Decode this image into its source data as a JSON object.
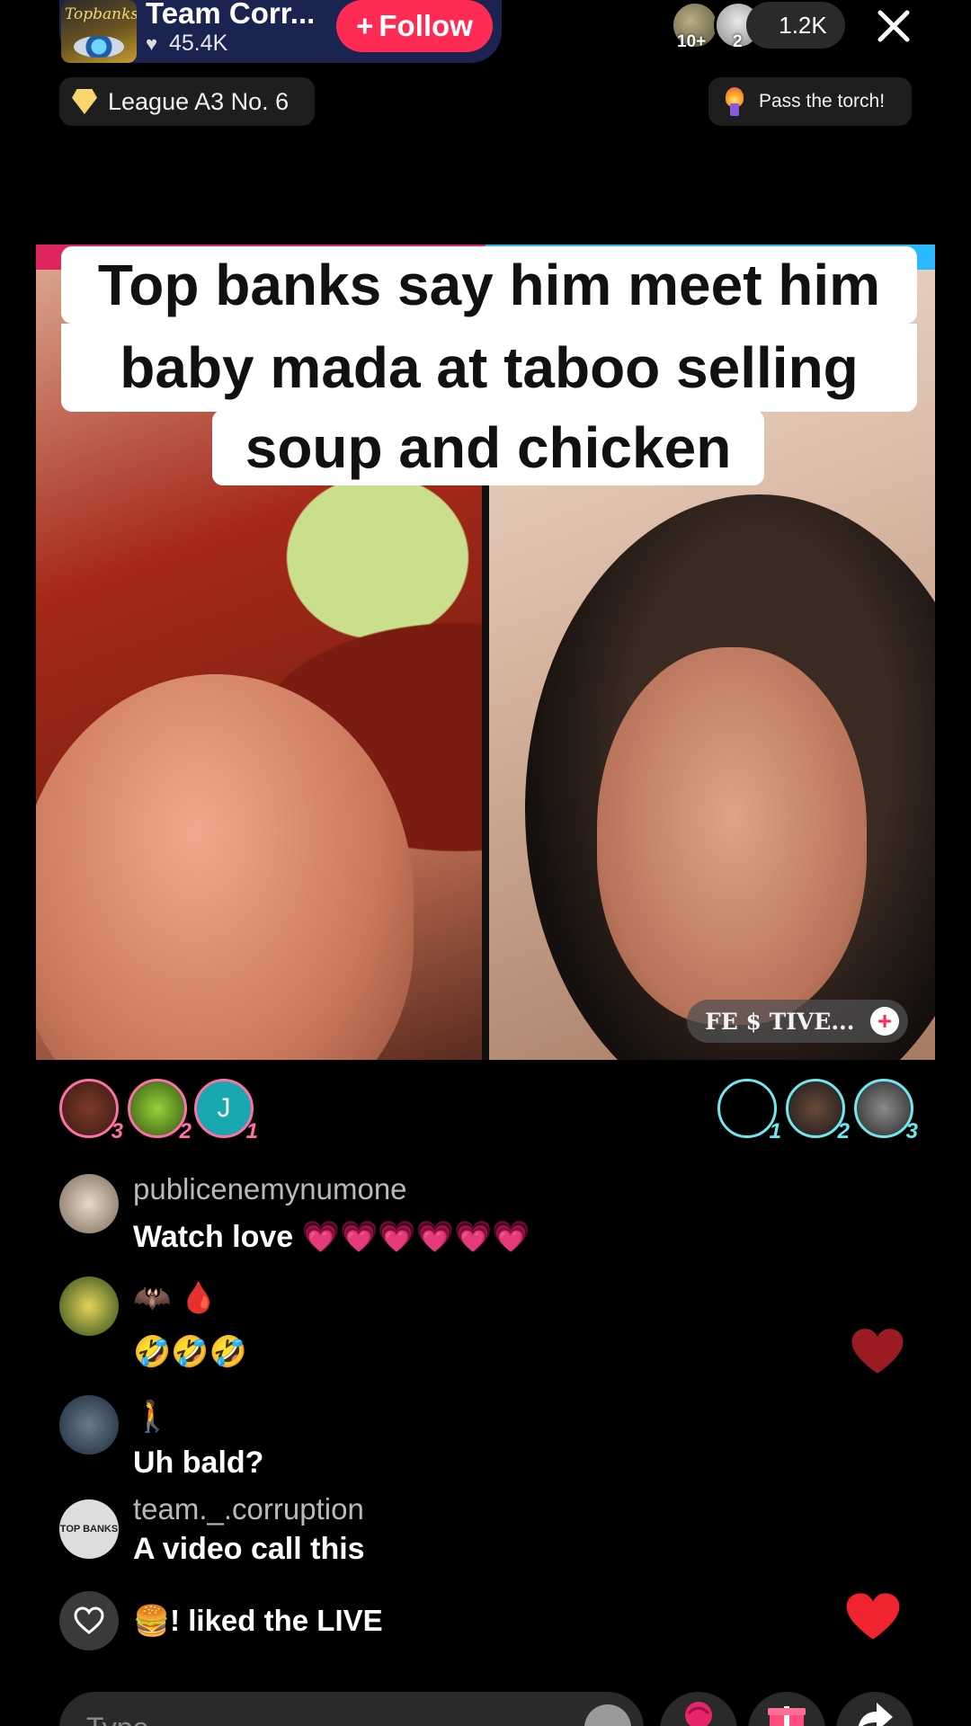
{
  "header": {
    "host_name": "Team Corr...",
    "host_logo_text": "Topbanks",
    "host_likes": "45.4K",
    "follow_label": "Follow",
    "viewer_badge_1": "10+",
    "viewer_badge_2": "2",
    "viewer_count": "1.2K",
    "league_label": "League A3 No. 6",
    "torch_label": "Pass the torch!"
  },
  "video": {
    "caption_line_1": "Top banks say him meet him",
    "caption_line_2": "baby mada at taboo selling",
    "caption_line_3": "soup and chicken",
    "guest_tag": "FE $ TIVE..."
  },
  "gifters": {
    "left": [
      {
        "rank": "3"
      },
      {
        "rank": "2"
      },
      {
        "initial": "J",
        "rank": "1"
      }
    ],
    "right": [
      {
        "rank": "1"
      },
      {
        "rank": "2"
      },
      {
        "rank": "3"
      }
    ]
  },
  "comments": [
    {
      "user": "publicenemynumone",
      "text": "Watch love 💗💗💗💗💗💗"
    },
    {
      "user": "🦇 🩸",
      "text": "🤣🤣🤣"
    },
    {
      "user": "🚶",
      "text": "Uh bald?"
    },
    {
      "user": "team._.corruption",
      "text": "A video call this",
      "avatar_text": "TOP BANKS"
    }
  ],
  "like_notice": "🍔! liked the LIVE",
  "input": {
    "placeholder": "Type..."
  },
  "colors": {
    "accent": "#fe2c55",
    "host_pill": "#1b2350",
    "gifter_left": "#ff6fa8",
    "gifter_right": "#6fe6f0"
  },
  "icons": [
    "heart-icon",
    "close-icon",
    "diamond-icon",
    "torch-icon",
    "plus-icon",
    "emoji-icon",
    "rose-gift-icon",
    "gift-box-icon",
    "share-icon"
  ]
}
